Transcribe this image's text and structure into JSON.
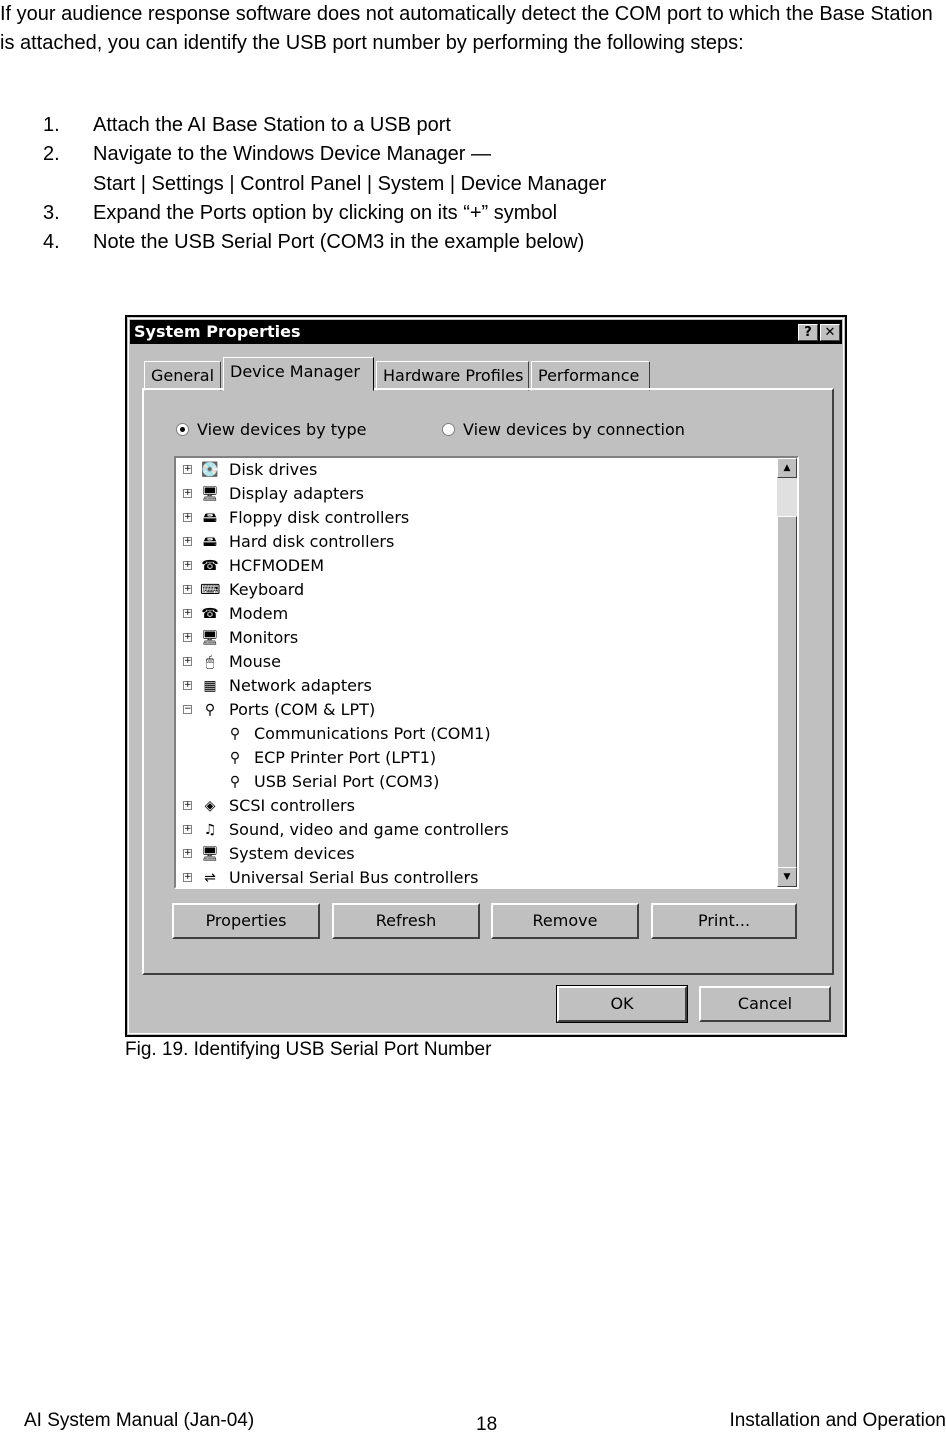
{
  "intro": "If your audience response software does not automatically detect the COM port to which the Base Station is attached, you can identify the USB port number by performing the following steps:",
  "steps": [
    {
      "num": "1.",
      "text": "Attach the AI Base Station to a USB port"
    },
    {
      "num": "2.",
      "text": "Navigate to the Windows Device Manager —",
      "text2": "Start | Settings | Control Panel | System | Device Manager"
    },
    {
      "num": "3.",
      "text": "Expand the Ports option by clicking on its “+” symbol"
    },
    {
      "num": "4.",
      "text": "Note the USB Serial Port (COM3 in the example below)"
    }
  ],
  "dialog": {
    "title": "System Properties",
    "help": "?",
    "close": "✕",
    "tabs": [
      "General",
      "Device Manager",
      "Hardware Profiles",
      "Performance"
    ],
    "radio_type": "View devices by type",
    "radio_conn": "View devices by connection",
    "tree": [
      {
        "label": "Disk drives",
        "icon": "💽",
        "expander": "+"
      },
      {
        "label": "Display adapters",
        "icon": "🖥",
        "expander": "+"
      },
      {
        "label": "Floppy disk controllers",
        "icon": "🖴",
        "expander": "+"
      },
      {
        "label": "Hard disk controllers",
        "icon": "🖴",
        "expander": "+"
      },
      {
        "label": "HCFMODEM",
        "icon": "☎",
        "expander": "+"
      },
      {
        "label": "Keyboard",
        "icon": "⌨",
        "expander": "+"
      },
      {
        "label": "Modem",
        "icon": "☎",
        "expander": "+"
      },
      {
        "label": "Monitors",
        "icon": "🖥",
        "expander": "+"
      },
      {
        "label": "Mouse",
        "icon": "🖱",
        "expander": "+"
      },
      {
        "label": "Network adapters",
        "icon": "▦",
        "expander": "+"
      },
      {
        "label": "Ports (COM & LPT)",
        "icon": "⚲",
        "expander": "−"
      },
      {
        "label": "Communications Port (COM1)",
        "icon": "⚲",
        "child": true
      },
      {
        "label": "ECP Printer Port (LPT1)",
        "icon": "⚲",
        "child": true
      },
      {
        "label": "USB Serial Port (COM3)",
        "icon": "⚲",
        "child": true
      },
      {
        "label": "SCSI controllers",
        "icon": "◈",
        "expander": "+"
      },
      {
        "label": "Sound, video and game controllers",
        "icon": "♫",
        "expander": "+"
      },
      {
        "label": "System devices",
        "icon": "🖥",
        "expander": "+"
      },
      {
        "label": "Universal Serial Bus controllers",
        "icon": "⇌",
        "expander": "+"
      }
    ],
    "buttons": [
      "Properties",
      "Refresh",
      "Remove",
      "Print..."
    ],
    "ok": "OK",
    "cancel": "Cancel"
  },
  "caption": "Fig. 19.  Identifying USB Serial Port Number",
  "footer": {
    "left": "AI System Manual (Jan-04)",
    "page": "18",
    "right": "Installation and Operation"
  }
}
